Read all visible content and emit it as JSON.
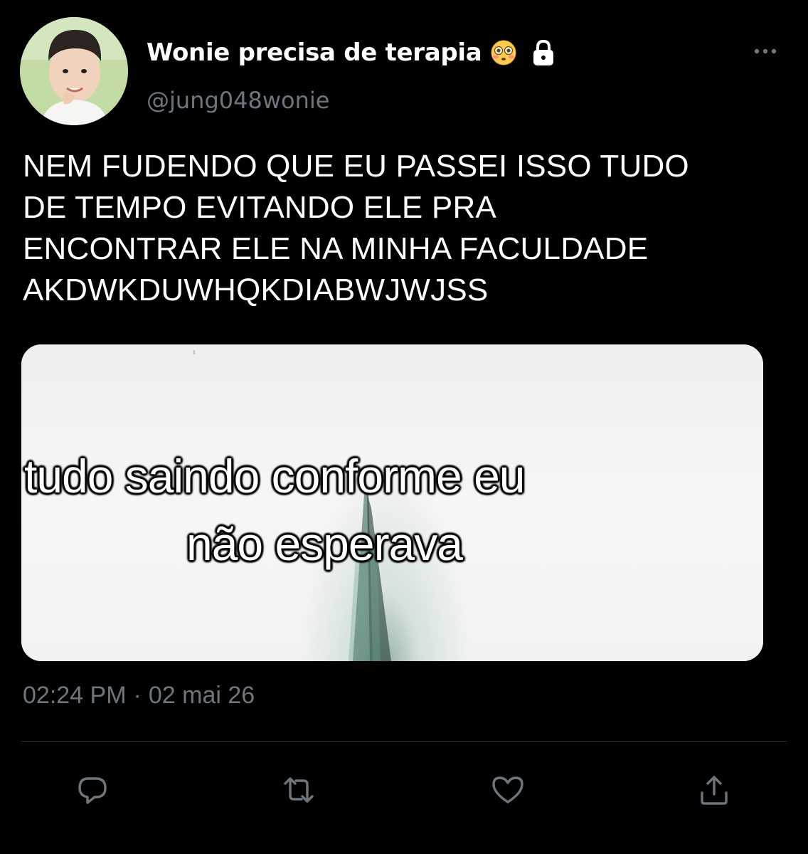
{
  "author": {
    "display_name": "Wonie precisa de terapia",
    "emoji": "flushed-face",
    "protected_icon": "lock-icon",
    "username": "@jung048wonie",
    "avatar": "avatar-photo"
  },
  "tweet": {
    "text": "NEM FUDENDO QUE EU PASSEI ISSO TUDO\nDE TEMPO EVITANDO ELE PRA\nENCONTRAR ELE NA MINHA FACULDADE\nAKDWKDUWHQKDIABWJWJSS",
    "media": {
      "caption_line1": "tudo saindo conforme eu",
      "caption_line2": "não esperava"
    },
    "time": "02:24 PM",
    "separator": "·",
    "date": "02 mai 26"
  },
  "actions": [
    {
      "name": "reply-button",
      "icon": "reply-icon"
    },
    {
      "name": "retweet-button",
      "icon": "retweet-icon"
    },
    {
      "name": "like-button",
      "icon": "heart-icon"
    },
    {
      "name": "share-button",
      "icon": "share-icon"
    }
  ],
  "colors": {
    "background": "#000000",
    "primary_text": "#ffffff",
    "secondary_text": "#6e767d",
    "divider": "#2f3336",
    "icon": "#6e767d"
  }
}
